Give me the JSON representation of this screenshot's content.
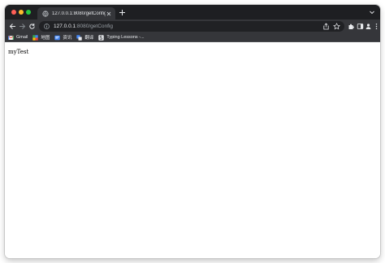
{
  "tab": {
    "title": "127.0.0.1:8080/getConfig"
  },
  "address_bar": {
    "host": "127.0.0.1",
    "rest": ":8080/getConfig"
  },
  "bookmarks": [
    {
      "label": "Gmail",
      "icon": "gmail-icon"
    },
    {
      "label": "地图",
      "icon": "maps-icon"
    },
    {
      "label": "资讯",
      "icon": "news-icon"
    },
    {
      "label": "翻译",
      "icon": "translate-icon"
    },
    {
      "label": "Typing Lessons -...",
      "icon": "typing-lessons-icon"
    }
  ],
  "page": {
    "body_text": "myTest"
  },
  "colors": {
    "tabstrip": "#1e1f22",
    "toolbar": "#35363a",
    "omnibox": "#202124",
    "close": "#ff5f57",
    "minimize": "#febc2e",
    "maximize": "#28c840"
  }
}
